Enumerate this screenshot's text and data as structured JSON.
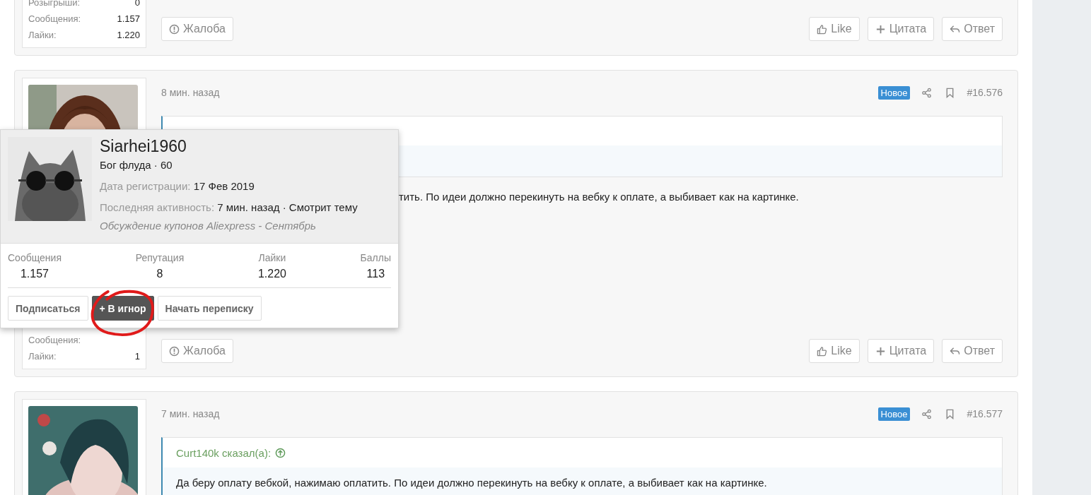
{
  "posts": [
    {
      "user": {
        "stats": [
          {
            "label": "Розыгрыши:",
            "value": "0"
          },
          {
            "label": "Сообщения:",
            "value": "1.157"
          },
          {
            "label": "Лайки:",
            "value": "1.220"
          }
        ]
      },
      "report": "Жалоба",
      "actions": [
        {
          "kind": "like",
          "label": "Like"
        },
        {
          "kind": "quote",
          "label": "Цитата"
        },
        {
          "kind": "reply",
          "label": "Ответ"
        }
      ]
    },
    {
      "user": {
        "stats": [
          {
            "label": "Сообщения:"
          },
          {
            "label": "Лайки:",
            "value": "1"
          }
        ]
      },
      "time": "8 мин. назад",
      "badge": "Новое",
      "number": "#16.576",
      "body": "тить. По идеи должно перекинуть на вебку к оплате, а выбивает как на картинке.",
      "report": "Жалоба",
      "actions": [
        {
          "kind": "like",
          "label": "Like"
        },
        {
          "kind": "quote",
          "label": "Цитата"
        },
        {
          "kind": "reply",
          "label": "Ответ"
        }
      ]
    },
    {
      "time": "7 мин. назад",
      "badge": "Новое",
      "number": "#16.577",
      "quote": {
        "author": "Curt140k сказал(а):",
        "text": "Да беру оплату вебкой, нажимаю оплатить. По идеи должно перекинуть на вебку к оплате, а выбивает как на картинке."
      }
    }
  ],
  "popup": {
    "name": "Siarhei1960",
    "title": "Бог флуда · 60",
    "registered": {
      "label": "Дата регистрации:",
      "value": "17 Фев 2019"
    },
    "activity": {
      "label": "Последняя активность:",
      "value": "7 мин. назад · Смотрит тему"
    },
    "thread": "Обсуждение купонов Aliexpress - Сентябрь",
    "stats": [
      {
        "label": "Сообщения",
        "value": "1.157"
      },
      {
        "label": "Репутация",
        "value": "8"
      },
      {
        "label": "Лайки",
        "value": "1.220"
      },
      {
        "label": "Баллы",
        "value": "113"
      }
    ],
    "buttons": [
      {
        "label": "Подписаться",
        "hovered": false
      },
      {
        "label": "+ В игнор",
        "hovered": true
      },
      {
        "label": "Начать переписку",
        "hovered": false
      }
    ]
  }
}
